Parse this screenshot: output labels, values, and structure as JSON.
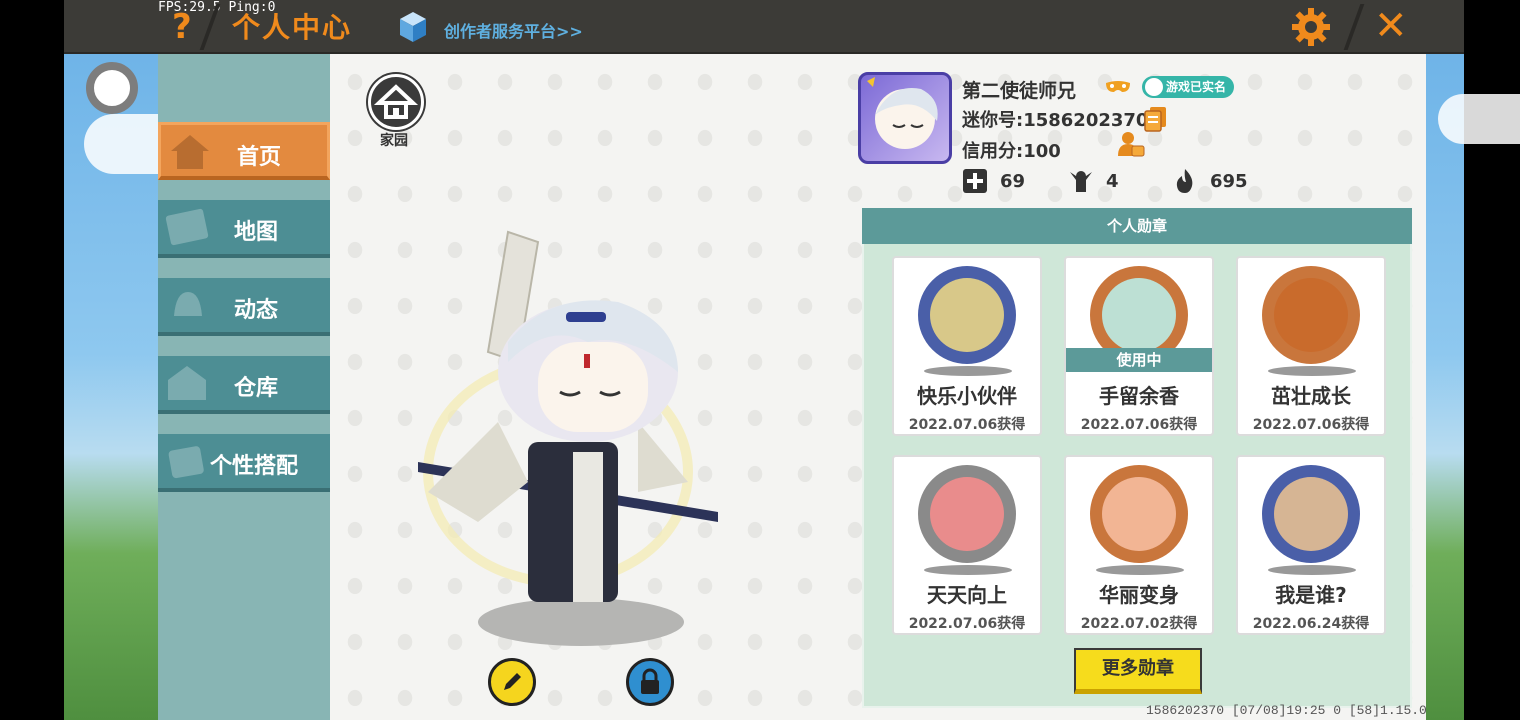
{
  "hud": {
    "fps_ping": "FPS:29.5  Ping:0"
  },
  "header": {
    "title": "个人中心",
    "help_glyph": "?",
    "creator_link": "创作者服务平台>>",
    "close_glyph": "✕",
    "accent": "#f08a1c"
  },
  "sidebar": {
    "items": [
      {
        "label": "首页",
        "icon": "home-icon",
        "active": true
      },
      {
        "label": "地图",
        "icon": "map-icon",
        "active": false
      },
      {
        "label": "动态",
        "icon": "bell-icon",
        "active": false
      },
      {
        "label": "仓库",
        "icon": "warehouse-icon",
        "active": false
      },
      {
        "label": "个性搭配",
        "icon": "outfit-icon",
        "active": false
      }
    ]
  },
  "home": {
    "label": "家园"
  },
  "profile": {
    "nickname": "第二使徒师兄",
    "verified_label": "游戏已实名",
    "mini_id": "迷你号:1586202370",
    "credit": "信用分:100",
    "stats": [
      {
        "icon": "friends-add-icon",
        "value": "69"
      },
      {
        "icon": "fans-icon",
        "value": "4"
      },
      {
        "icon": "flame-icon",
        "value": "695"
      }
    ]
  },
  "badges": {
    "header": "个人勋章",
    "in_use_label": "使用中",
    "items": [
      {
        "name": "快乐小伙伴",
        "date": "2022.07.06获得",
        "ring": "#4a5fa8",
        "fill": "#d8c889",
        "in_use": false
      },
      {
        "name": "手留余香",
        "date": "2022.07.06获得",
        "ring": "#c9763c",
        "fill": "#bde0d4",
        "in_use": true
      },
      {
        "name": "茁壮成长",
        "date": "2022.07.06获得",
        "ring": "#c9763c",
        "fill": "#c96b2c",
        "in_use": false
      },
      {
        "name": "天天向上",
        "date": "2022.07.06获得",
        "ring": "#8a8a8a",
        "fill": "#e98c8c",
        "in_use": false
      },
      {
        "name": "华丽变身",
        "date": "2022.07.02获得",
        "ring": "#c9763c",
        "fill": "#f2b594",
        "in_use": false
      },
      {
        "name": "我是谁?",
        "date": "2022.06.24获得",
        "ring": "#4a5fa8",
        "fill": "#d6b594",
        "in_use": false
      }
    ],
    "more_label": "更多勋章"
  },
  "footer": {
    "info": "1586202370   [07/08]19:25 0   [58]1.15.0"
  }
}
